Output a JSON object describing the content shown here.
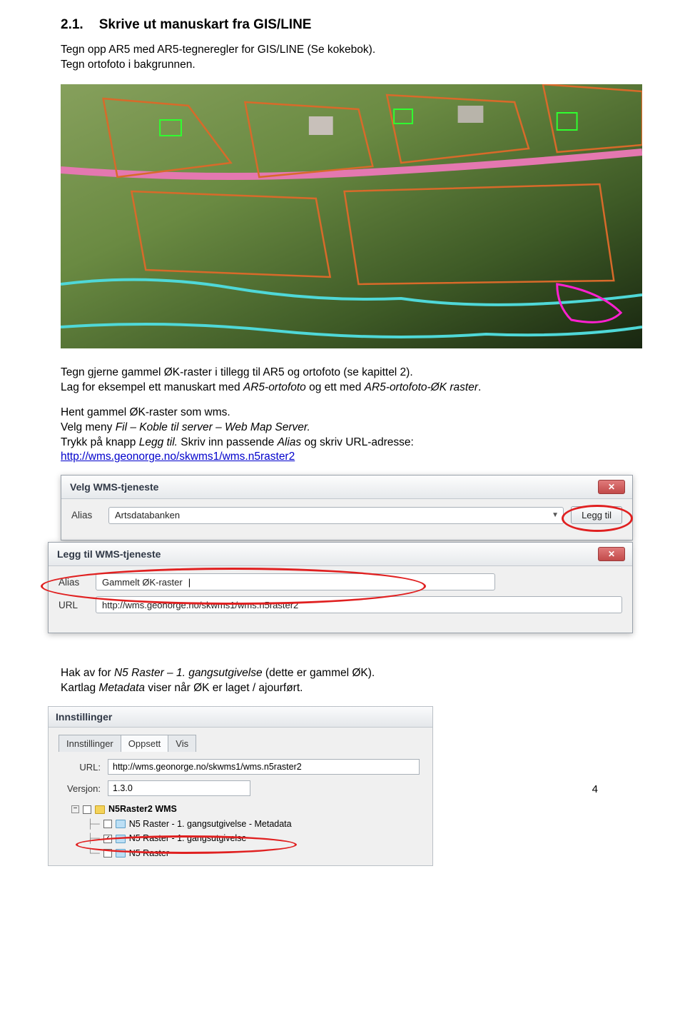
{
  "section_number": "2.1.",
  "section_title": "Skrive ut manuskart fra GIS/LINE",
  "intro_line1": "Tegn opp AR5 med AR5-tegneregler for GIS/LINE (Se kokebok).",
  "intro_line2": "Tegn ortofoto i bakgrunnen.",
  "para1_part1": "Tegn gjerne gammel ØK-raster i tillegg til AR5 og ortofoto (se kapittel 2).",
  "para1_part2a": "Lag for eksempel ett manuskart med ",
  "para1_italic1": "AR5-ortofoto",
  "para1_part2b": " og ett med ",
  "para1_italic2": "AR5-ortofoto-ØK raster",
  "para1_part2c": ".",
  "para2_line1": "Hent gammel ØK-raster som wms.",
  "para2_line2a": "Velg meny ",
  "para2_italic": "Fil – Koble til server – Web Map Server.",
  "para2_line3a": "Trykk på knapp ",
  "para2_italic2": "Legg til.",
  "para2_line3b": " Skriv inn passende ",
  "para2_italic3": "Alias",
  "para2_line3c": " og skriv URL-adresse:",
  "url_link": "http://wms.geonorge.no/skwms1/wms.n5raster2",
  "dialog1": {
    "title": "Velg WMS-tjeneste",
    "alias_label": "Alias",
    "alias_value": "Artsdatabanken",
    "legg_til": "Legg til"
  },
  "dialog2": {
    "title": "Legg til WMS-tjeneste",
    "alias_label": "Alias",
    "alias_value": "Gammelt ØK-raster",
    "url_label": "URL",
    "url_value": "http://wms.geonorge.no/skwms1/wms.n5raster2"
  },
  "bottom_text_a": "Hak av for ",
  "bottom_italic1": "N5 Raster – 1. gangsutgivelse",
  "bottom_text_b": " (dette er gammel ØK).",
  "bottom_text_c_a": "Kartlag ",
  "bottom_italic2": "Metadata",
  "bottom_text_c_b": " viser når ØK er laget / ajourført.",
  "settings": {
    "title": "Innstillinger",
    "tab1": "Innstillinger",
    "tab2": "Oppsett",
    "tab3": "Vis",
    "url_label": "URL:",
    "url_value": "http://wms.geonorge.no/skwms1/wms.n5raster2",
    "version_label": "Versjon:",
    "version_value": "1.3.0",
    "root": "N5Raster2 WMS",
    "layer1": "N5 Raster - 1. gangsutgivelse - Metadata",
    "layer2": "N5 Raster - 1. gangsutgivelse",
    "layer3": "N5 Raster"
  },
  "page_number": "4"
}
